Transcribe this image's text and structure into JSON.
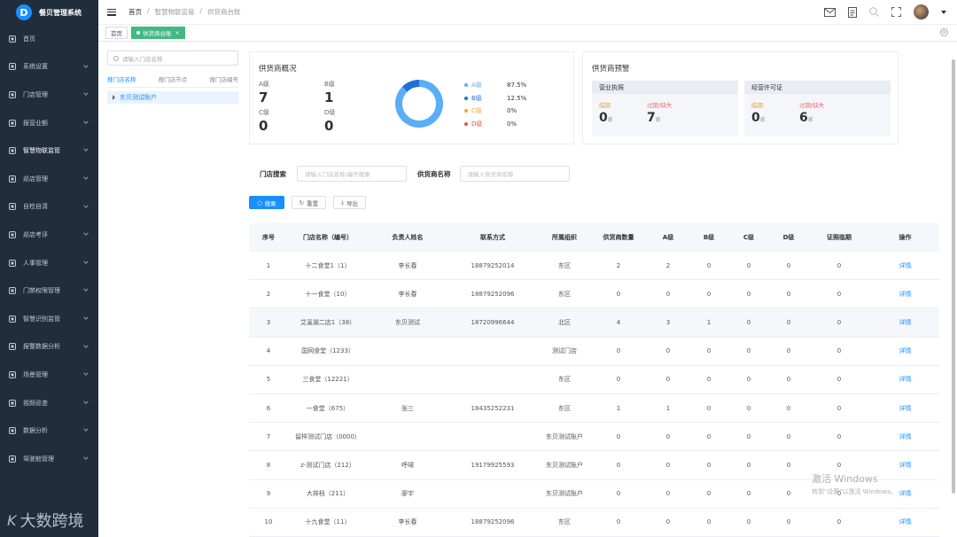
{
  "app": {
    "title": "餐贝管理系统",
    "logo_char": "D"
  },
  "menu": [
    {
      "label": "首页",
      "icon": "dashboard-icon",
      "has_children": false
    },
    {
      "label": "系统设置",
      "icon": "user-icon",
      "has_children": true
    },
    {
      "label": "门店管理",
      "icon": "store-icon",
      "has_children": true
    },
    {
      "label": "报营业额",
      "icon": "document-icon",
      "has_children": true
    },
    {
      "label": "智慧物联监管",
      "icon": "gear-icon",
      "has_children": true,
      "active": true
    },
    {
      "label": "巡店管理",
      "icon": "grid-icon",
      "has_children": true
    },
    {
      "label": "自检自清",
      "icon": "checklist-icon",
      "has_children": true
    },
    {
      "label": "巡店考评",
      "icon": "list-icon",
      "has_children": true
    },
    {
      "label": "人事管理",
      "icon": "person-icon",
      "has_children": true
    },
    {
      "label": "门禁权限管理",
      "icon": "door-icon",
      "has_children": true
    },
    {
      "label": "智慧识别监管",
      "icon": "eye-icon",
      "has_children": true
    },
    {
      "label": "报警数据分析",
      "icon": "alarm-icon",
      "has_children": true
    },
    {
      "label": "场景管理",
      "icon": "picture-icon",
      "has_children": true
    },
    {
      "label": "视频巡查",
      "icon": "video-icon",
      "has_children": true
    },
    {
      "label": "数据分析",
      "icon": "chart-icon",
      "has_children": true
    },
    {
      "label": "驾驶舱管理",
      "icon": "cockpit-icon",
      "has_children": true
    }
  ],
  "watermark": {
    "logo": "K",
    "text": "大数跨境"
  },
  "breadcrumb": [
    "首页",
    "智慧物联监管",
    "供货商台账"
  ],
  "tags": {
    "home": "首页",
    "active": "供货商台账",
    "close": "×"
  },
  "tree": {
    "search_placeholder": "请输入门店名称",
    "tabs": [
      "搜门店名称",
      "搜门店节点",
      "搜门店编号"
    ],
    "node": "东贝测试账户"
  },
  "overview": {
    "title": "供货商概况",
    "grades": [
      {
        "label": "A级",
        "value": "7"
      },
      {
        "label": "B级",
        "value": "1"
      },
      {
        "label": "C级",
        "value": "0"
      },
      {
        "label": "D级",
        "value": "0"
      }
    ],
    "legend": [
      {
        "name": "A级",
        "pct": "87.5%",
        "color": "#5aaef5"
      },
      {
        "name": "B级",
        "pct": "12.5%",
        "color": "#1f6fd6"
      },
      {
        "name": "C级",
        "pct": "0%",
        "color": "#f6a623"
      },
      {
        "name": "D级",
        "pct": "0%",
        "color": "#e5534b"
      }
    ]
  },
  "chart_data": {
    "type": "pie",
    "categories": [
      "A级",
      "B级",
      "C级",
      "D级"
    ],
    "values": [
      87.5,
      12.5,
      0,
      0
    ]
  },
  "warning": {
    "title": "供货商预警",
    "boxes": [
      {
        "header": "营业执照",
        "near_label": "临期",
        "near_value": "0",
        "expired_label": "过期/缺失",
        "expired_value": "7",
        "unit": "家"
      },
      {
        "header": "经营许可证",
        "near_label": "临期",
        "near_value": "0",
        "expired_label": "过期/缺失",
        "expired_value": "6",
        "unit": "家"
      }
    ]
  },
  "search": {
    "store_label": "门店搜索",
    "store_placeholder": "请输入门店名称/编号搜索",
    "supplier_label": "供货商名称",
    "supplier_placeholder": "请输入供货商名称",
    "search_btn": "搜索",
    "reset_btn": "重置",
    "export_btn": "导出"
  },
  "table": {
    "columns": [
      "序号",
      "门店名称（编号）",
      "负责人姓名",
      "联系方式",
      "所属组织",
      "供货商数量",
      "A级",
      "B级",
      "C级",
      "D级",
      "证照临期",
      "操作"
    ],
    "rows": [
      [
        "1",
        "十二食堂1（1）",
        "李长春",
        "18879252014",
        "东区",
        "2",
        "2",
        "0",
        "0",
        "0",
        "0",
        "详情"
      ],
      [
        "2",
        "十一食堂（10）",
        "李长春",
        "18879252096",
        "东区",
        "0",
        "0",
        "0",
        "0",
        "0",
        "0",
        "详情"
      ],
      [
        "3",
        "艾溪湖二店1（38）",
        "东贝测试",
        "18720996644",
        "北区",
        "4",
        "3",
        "1",
        "0",
        "0",
        "0",
        "详情"
      ],
      [
        "4",
        "国网食堂（1233）",
        "",
        "",
        "测试门店",
        "0",
        "0",
        "0",
        "0",
        "0",
        "0",
        "详情"
      ],
      [
        "5",
        "三食堂（12221）",
        "",
        "",
        "东区",
        "0",
        "0",
        "0",
        "0",
        "0",
        "0",
        "详情"
      ],
      [
        "6",
        "一食堂（675）",
        "张三",
        "18435252231",
        "东区",
        "1",
        "1",
        "0",
        "0",
        "0",
        "0",
        "详情"
      ],
      [
        "7",
        "留样测试门店（0000）",
        "",
        "",
        "东贝测试账户",
        "0",
        "0",
        "0",
        "0",
        "0",
        "0",
        "详情"
      ],
      [
        "8",
        "z-测试门店（212）",
        "呼啸",
        "19179925593",
        "东贝测试账户",
        "0",
        "0",
        "0",
        "0",
        "0",
        "0",
        "详情"
      ],
      [
        "9",
        "大排档（211）",
        "廖宇",
        "",
        "东贝测试账户",
        "0",
        "0",
        "0",
        "0",
        "0",
        "0",
        "详情"
      ],
      [
        "10",
        "十九食堂（11）",
        "李长春",
        "18879252096",
        "东区",
        "0",
        "0",
        "0",
        "0",
        "0",
        "0",
        "详情"
      ]
    ],
    "highlight_row": 3
  },
  "windows_activation": {
    "line1": "激活 Windows",
    "line2": "转到\"设置\"以激活 Windows。"
  }
}
